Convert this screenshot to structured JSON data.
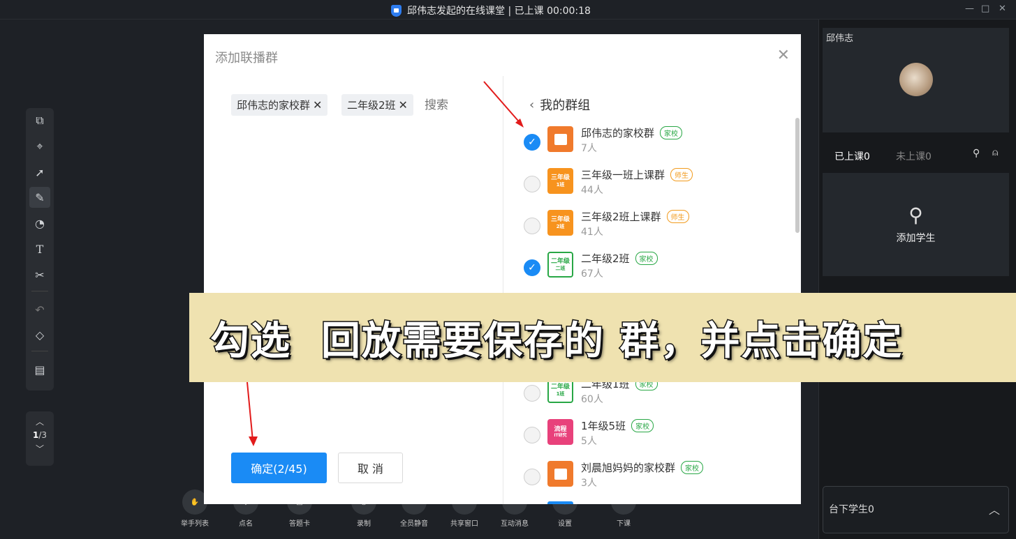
{
  "window": {
    "title": "邱伟志发起的在线课堂 | 已上课 00:00:18",
    "min": "—",
    "max": "□",
    "close": "✕"
  },
  "dialog": {
    "title": "添加联播群",
    "search_placeholder": "搜索",
    "confirm": "确定(2/45)",
    "cancel": "取 消",
    "chips": [
      "邱伟志的家校群",
      "二年级2班"
    ],
    "groups_header": "我的群组"
  },
  "groups": [
    {
      "name": "邱伟志的家校群",
      "count": "7人",
      "tag": "家校",
      "tag_type": "jx",
      "checked": true,
      "avatar": "book",
      "avatar_color": "#f07a2c"
    },
    {
      "name": "三年级一班上课群",
      "count": "44人",
      "tag": "师生",
      "tag_type": "ss",
      "checked": false,
      "avatar_line1": "三年级",
      "avatar_line2": "1班",
      "avatar_color": "#f7931e"
    },
    {
      "name": "三年级2班上课群",
      "count": "41人",
      "tag": "师生",
      "tag_type": "ss",
      "checked": false,
      "avatar_line1": "三年级",
      "avatar_line2": "2班",
      "avatar_color": "#f7931e"
    },
    {
      "name": "二年级2班",
      "count": "67人",
      "tag": "家校",
      "tag_type": "jx",
      "checked": true,
      "avatar_line1": "二年级",
      "avatar_line2": "二班",
      "avatar_color": "#ffffff"
    },
    {
      "name": "二年级1班",
      "count": "60人",
      "tag": "家校",
      "tag_type": "jx",
      "checked": false,
      "avatar_line1": "二年级",
      "avatar_line2": "1班",
      "avatar_color": "#ffffff"
    },
    {
      "name": "1年级5班",
      "count": "5人",
      "tag": "家校",
      "tag_type": "jx",
      "checked": false,
      "avatar_line1": "流程",
      "avatar_line2": "IT研究",
      "avatar_color": "#e8417b"
    },
    {
      "name": "刘晨旭妈妈的家校群",
      "count": "3人",
      "tag": "家校",
      "tag_type": "jx",
      "checked": false,
      "avatar": "book",
      "avatar_color": "#f07a2c"
    }
  ],
  "banner": "勾选  回放需要保存的 群，并点击确定",
  "pager": {
    "current": "1",
    "total": "/3"
  },
  "bottom": [
    "举手列表",
    "点名",
    "答题卡",
    "录制",
    "全员静音",
    "共享窗口",
    "互动消息",
    "设置",
    "下课"
  ],
  "right": {
    "teacher": "邱伟志",
    "tab_on": "已上课0",
    "tab_off": "未上课0",
    "add_student": "添加学生",
    "offline": "台下学生0"
  },
  "colors": {
    "accent": "#1a8bf5",
    "tag_green": "#28a745",
    "tag_orange": "#f29b1d"
  }
}
